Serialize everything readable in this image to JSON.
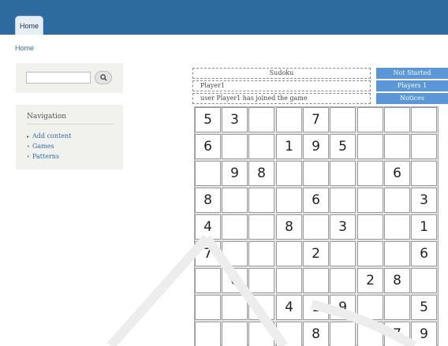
{
  "header": {
    "tab_home": "Home"
  },
  "breadcrumb": {
    "home": "Home"
  },
  "search": {
    "value": "",
    "button_icon": "search-icon"
  },
  "navigation": {
    "title": "Navigation",
    "items": [
      {
        "label": "Add content",
        "bullet": "▸"
      },
      {
        "label": "Games",
        "bullet": "•"
      },
      {
        "label": "Patterns",
        "bullet": "•"
      }
    ]
  },
  "game": {
    "title": "Sudoku",
    "player": "Player1",
    "message": "user Player1 has joined the game",
    "status": "Not Started",
    "players": "Players 1",
    "notices": "Notices"
  },
  "grid": [
    [
      "5",
      "3",
      "",
      "",
      "7",
      "",
      "",
      "",
      ""
    ],
    [
      "6",
      "",
      "",
      "1",
      "9",
      "5",
      "",
      "",
      ""
    ],
    [
      "",
      "9",
      "8",
      "",
      "",
      "",
      "",
      "6",
      ""
    ],
    [
      "8",
      "",
      "",
      "",
      "6",
      "",
      "",
      "",
      "3"
    ],
    [
      "4",
      "",
      "",
      "8",
      "",
      "3",
      "",
      "",
      "1"
    ],
    [
      "7",
      "",
      "",
      "",
      "2",
      "",
      "",
      "",
      "6"
    ],
    [
      "",
      "6",
      "",
      "",
      "",
      "",
      "2",
      "8",
      ""
    ],
    [
      "",
      "",
      "",
      "4",
      "1",
      "9",
      "",
      "",
      "5"
    ],
    [
      "",
      "",
      "",
      "",
      "8",
      "",
      "",
      "7",
      "9"
    ]
  ],
  "colors": {
    "topbar": "#2d6b9e",
    "status_button": "#5b97d6",
    "link": "#2d6ba6"
  }
}
